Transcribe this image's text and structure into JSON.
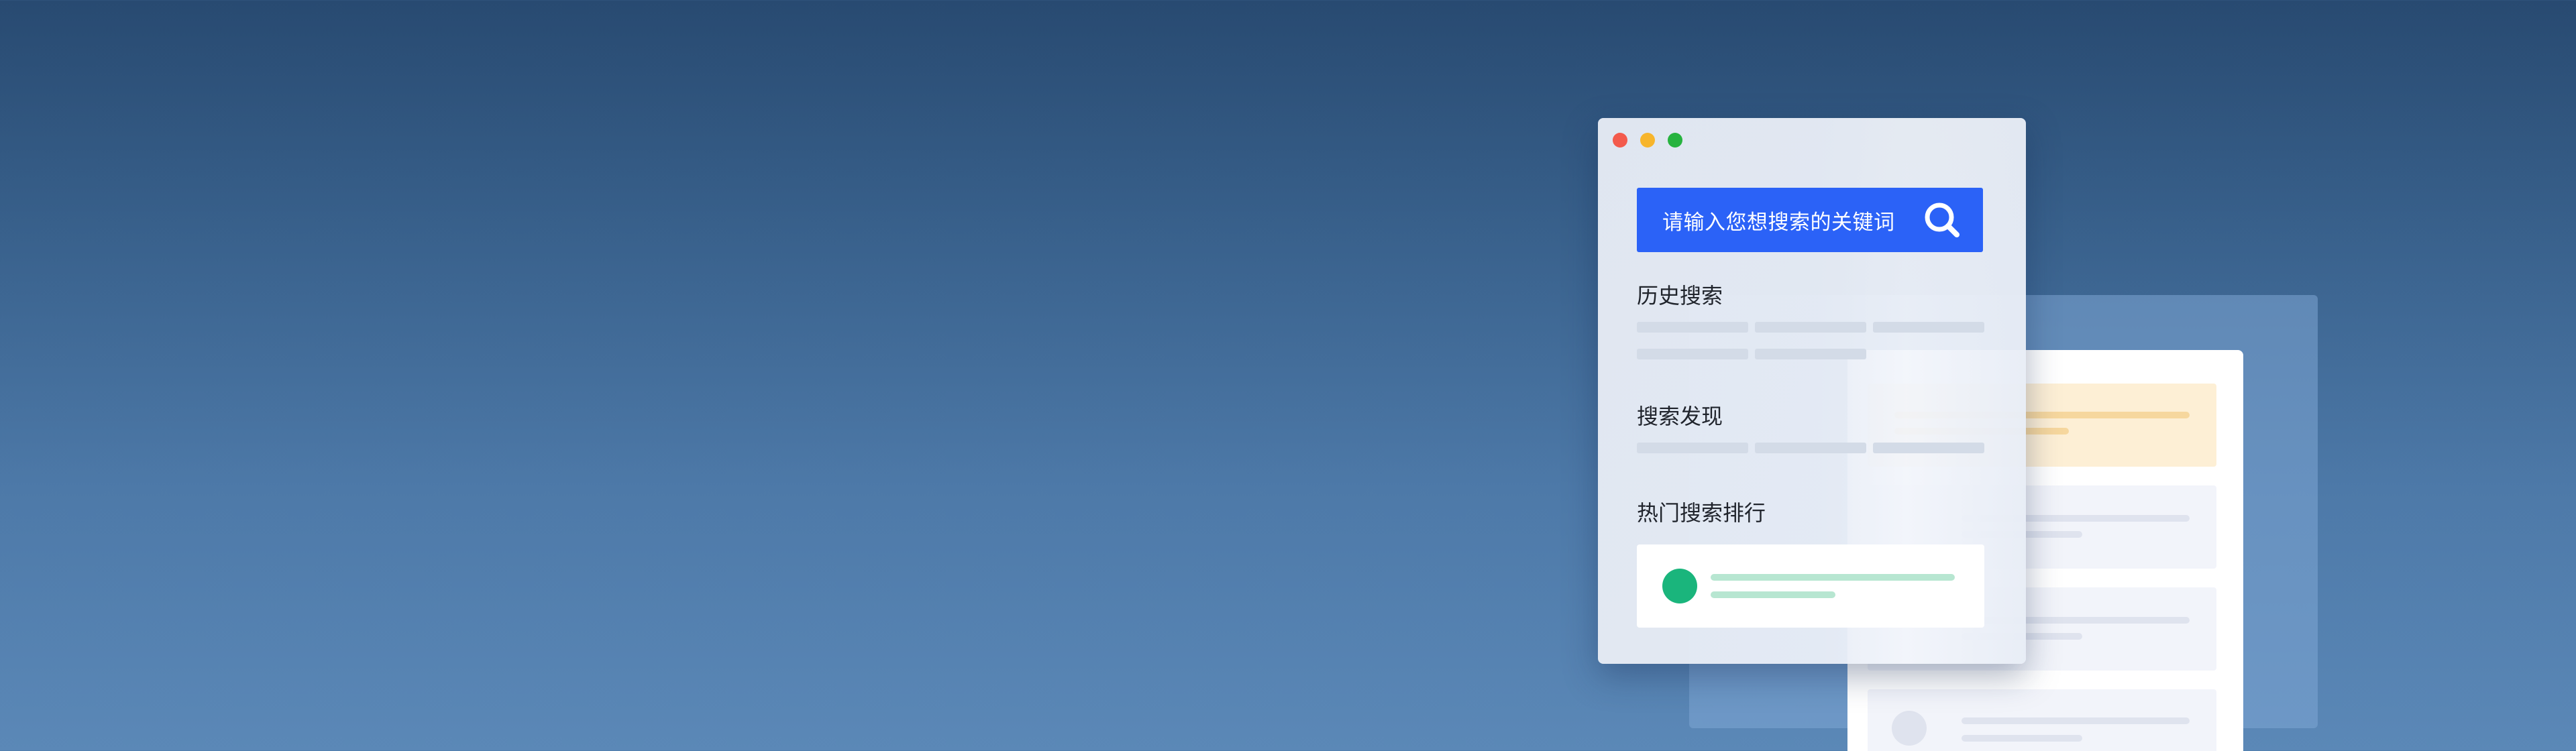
{
  "search": {
    "placeholder": "请输入您想搜索的关键词",
    "icon": "search-icon"
  },
  "sections": {
    "history_title": "历史搜索",
    "discover_title": "搜索发现",
    "hot_title": "热门搜索排行"
  },
  "window_controls": [
    "close",
    "minimize",
    "maximize"
  ],
  "colors": {
    "accent": "#2b62f7",
    "hot_dot": "#1ab57c",
    "featured_card": "#fdefd5",
    "traffic_red": "#f35a4c",
    "traffic_yellow": "#f7b52c",
    "traffic_green": "#27b33f"
  }
}
